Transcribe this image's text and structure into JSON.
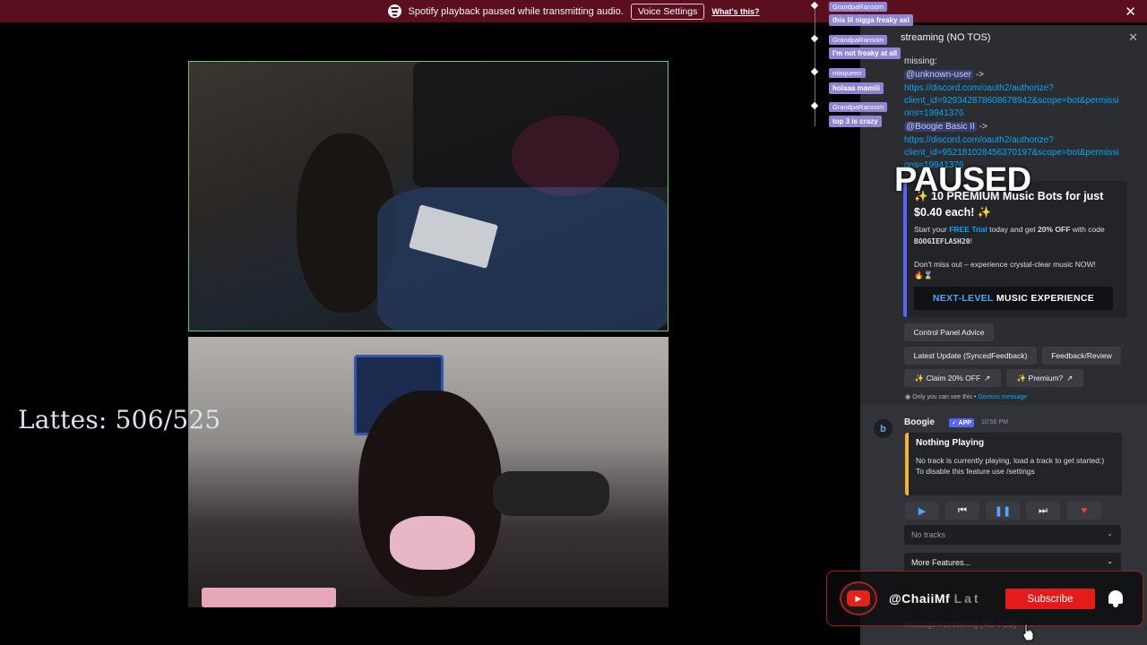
{
  "notice": {
    "text": "Spotify playback paused while transmitting audio.",
    "button": "Voice Settings",
    "link": "What's this?"
  },
  "overlay": {
    "lattes": "Lattes: 506/525",
    "paused": "PAUSED"
  },
  "chat": [
    {
      "user": "GrandpaRansom",
      "message": "this lil nigga freaky asl"
    },
    {
      "user": "GrandpaRansom",
      "message": "I'm not freaky at all"
    },
    {
      "user": "mixqueen",
      "message": "holaaa mamiii"
    },
    {
      "user": "GrandpaRansom",
      "message": "top 3 is crazy"
    }
  ],
  "discord": {
    "thread_title": "streaming (NO TOS)",
    "missing_label": "missing:",
    "mention1": "@unknown-user",
    "link1_a": "https://discord.com/oauth2/authorize?",
    "link1_b": "client_id=929342878608678942&scope=bot&permissi",
    "link1_c": "ons=19941376",
    "mention2": "@Boogie Basic II",
    "link2_a": "https://discord.com/oauth2/authorize?",
    "link2_b": "client_id=952181028456370197&scope=bot&permissi",
    "link2_c": "ons=19941376",
    "arrow": "->",
    "promo": {
      "title_a": "✨ 10 PREMIUM Music Bots for just",
      "title_b": "$0.40 each! ✨",
      "body_a": "Start your",
      "body_free": "FREE Trial",
      "body_b": "today and get",
      "body_off": "20% OFF",
      "body_c": "with",
      "body_code_pre": "code",
      "code": "BOOGIEFLASH20",
      "body_d": "!",
      "body2": "Don't miss out – experience crystal-clear music NOW!",
      "emojis": "🔥⌛",
      "banner_accent": "NEXT-LEVEL",
      "banner_rest": "MUSIC EXPERIENCE"
    },
    "buttons": {
      "control_panel": "Control Panel Advice",
      "latest_update": "Latest Update (SyncedFeedback)",
      "feedback": "Feedback/Review",
      "claim": "✨ Claim 20% OFF",
      "premium": "✨ Premium?"
    },
    "ephemeral": "Only you can see this •",
    "dismiss": "Dismiss message",
    "bot": {
      "name": "Boogie",
      "badge": "✓ APP",
      "time": "10:56 PM",
      "np_title": "Nothing Playing",
      "np_body_a": "No track is currently playing, load a track to get started;)",
      "np_body_b": "To disable this feature use /settings"
    },
    "select_tracks": "No tracks",
    "select_more": "More Features...",
    "message_placeholder": "Message #streaming (NO TOS)"
  },
  "youtube": {
    "handle_main": "@ChaiiMf",
    "handle_fade": "Lat",
    "subscribe": "Subscribe"
  },
  "colors": {
    "notice_bg": "#5b0f1e",
    "discord_bg": "#2b2d31",
    "accent_blue": "#5865f2",
    "link_blue": "#00a8fc",
    "subscribe_red": "#e31b1b"
  }
}
